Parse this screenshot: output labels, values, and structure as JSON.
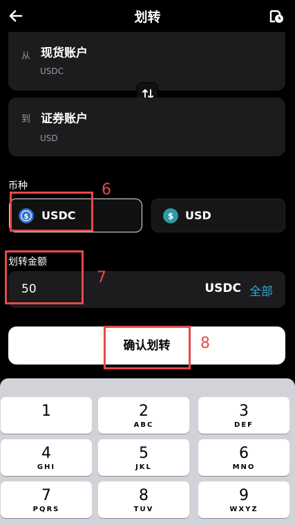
{
  "header": {
    "title": "划转",
    "back_icon": "back-arrow-icon",
    "history_icon": "history-clock-icon"
  },
  "from": {
    "label": "从",
    "account": "现货账户",
    "currency": "USDC"
  },
  "to": {
    "label": "到",
    "account": "证券账户",
    "currency": "USD"
  },
  "swap_icon": "swap-arrows-icon",
  "coin_section": {
    "label": "币种",
    "options": [
      {
        "name": "USDC",
        "icon": "usdc-coin-icon",
        "selected": true,
        "color": "#2f6fd3"
      },
      {
        "name": "USD",
        "icon": "usd-coin-icon",
        "selected": false,
        "color": "#2d9aa8"
      }
    ]
  },
  "amount_section": {
    "label": "划转金额",
    "value": "50",
    "currency": "USDC",
    "all_label": "全部"
  },
  "confirm_label": "确认划转",
  "annotations": [
    "6",
    "7",
    "8"
  ],
  "colors": {
    "accent": "#2ea8d6",
    "annotation": "#e84a4a",
    "background": "#000000",
    "card": "#1c1c1e"
  },
  "keypad": [
    {
      "digit": "1",
      "letters": ""
    },
    {
      "digit": "2",
      "letters": "ABC"
    },
    {
      "digit": "3",
      "letters": "DEF"
    },
    {
      "digit": "4",
      "letters": "GHI"
    },
    {
      "digit": "5",
      "letters": "JKL"
    },
    {
      "digit": "6",
      "letters": "MNO"
    },
    {
      "digit": "7",
      "letters": "PQRS"
    },
    {
      "digit": "8",
      "letters": "TUV"
    },
    {
      "digit": "9",
      "letters": "WXYZ"
    }
  ]
}
